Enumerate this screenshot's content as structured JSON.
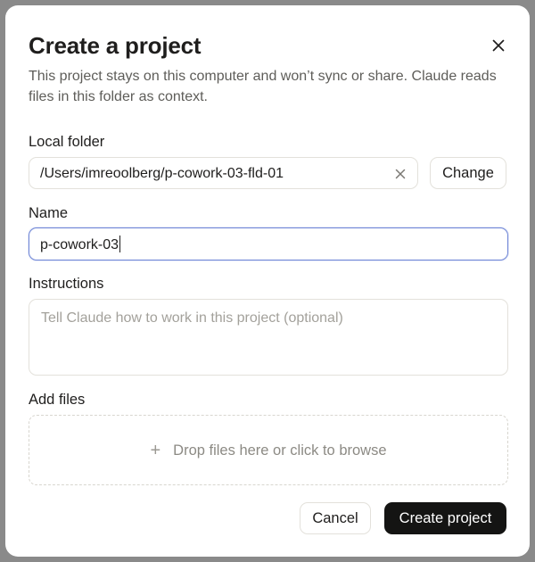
{
  "dialog": {
    "title": "Create a project",
    "description": "This project stays on this computer and won’t sync or share. Claude reads files in this folder as context.",
    "close_icon": "close-icon"
  },
  "local_folder": {
    "label": "Local folder",
    "value": "/Users/imreoolberg/p-cowork-03-fld-01",
    "clear_icon": "clear-icon",
    "change_label": "Change"
  },
  "name": {
    "label": "Name",
    "value": "p-cowork-03"
  },
  "instructions": {
    "label": "Instructions",
    "placeholder": "Tell Claude how to work in this project (optional)",
    "value": ""
  },
  "add_files": {
    "label": "Add files",
    "icon": "plus-icon",
    "prompt": "Drop files here or click to browse"
  },
  "actions": {
    "cancel_label": "Cancel",
    "create_label": "Create project"
  },
  "colors": {
    "primary_button": "#141413",
    "focus_ring": "#6f86d6",
    "backdrop": "#8a8a8a"
  }
}
